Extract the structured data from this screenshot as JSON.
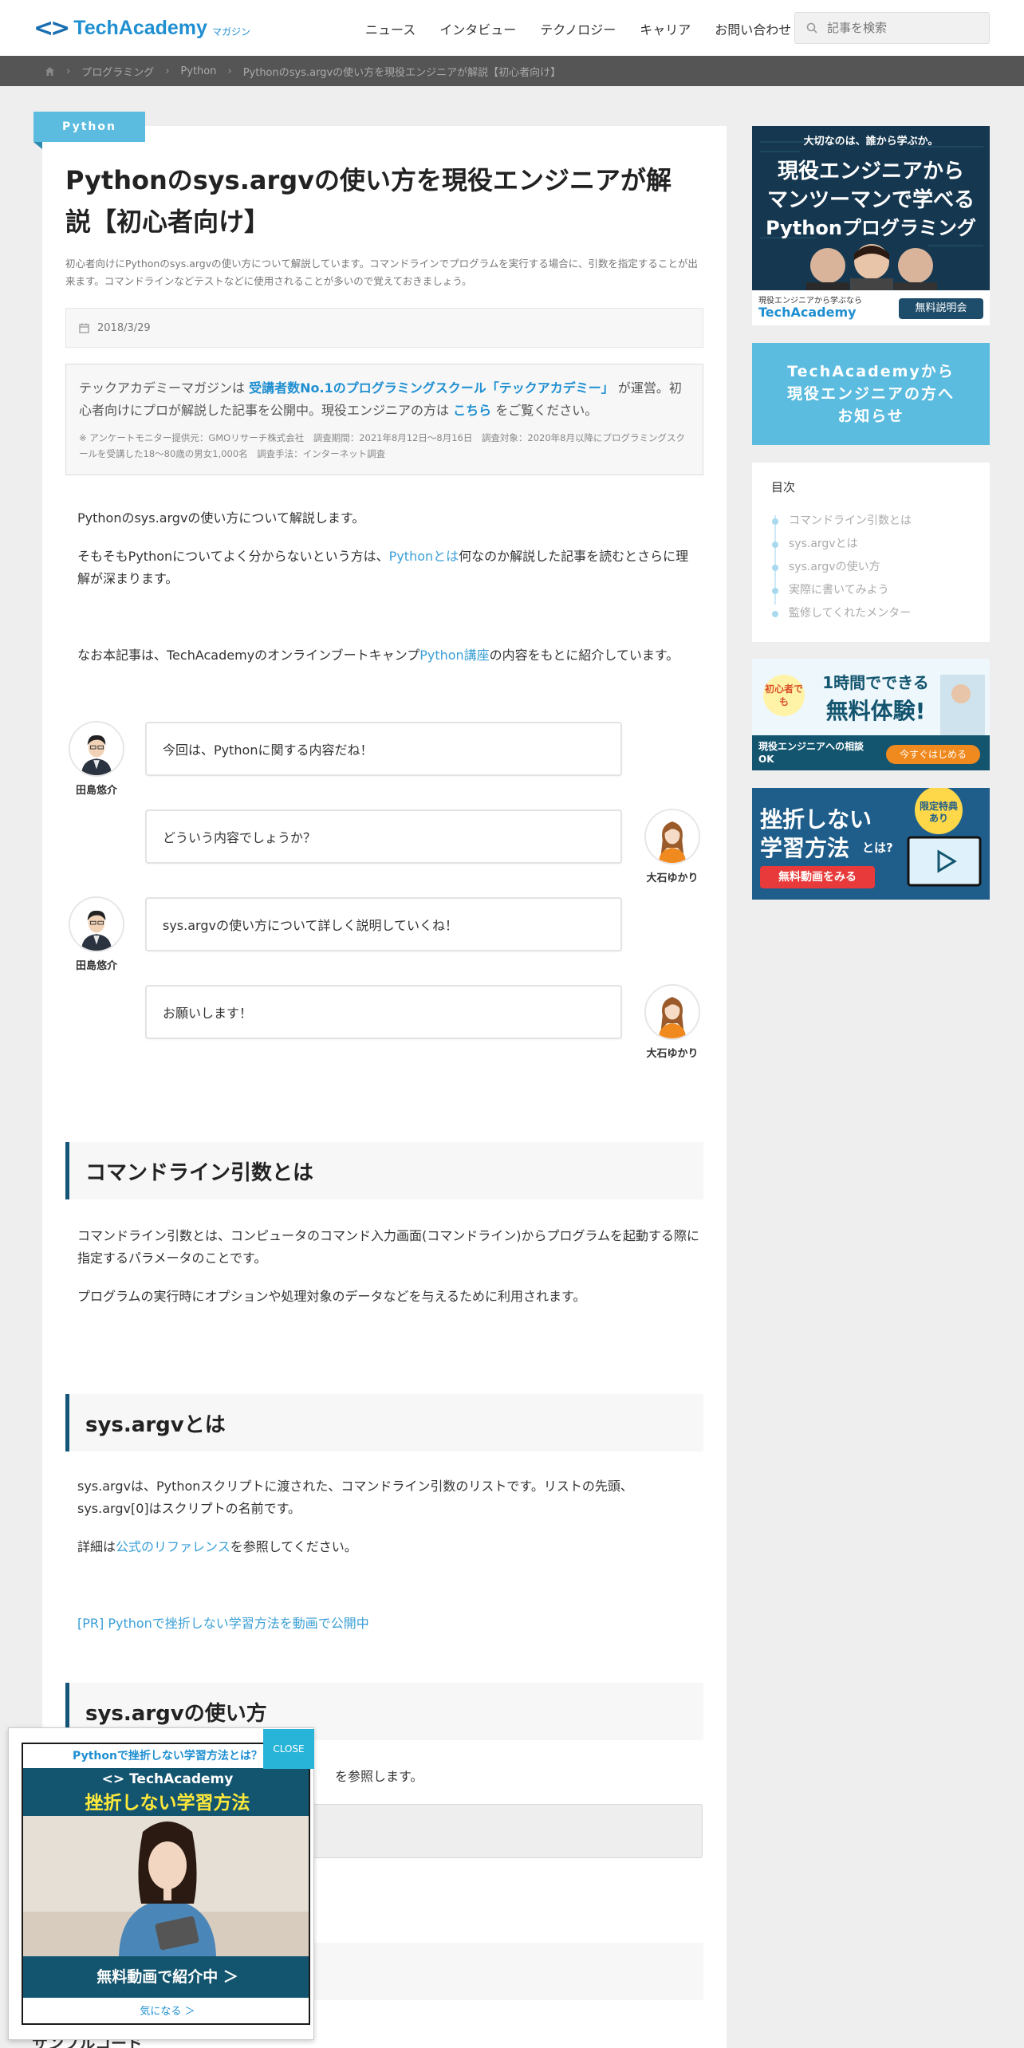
{
  "header": {
    "logo_mark": "<>",
    "logo_text": "TechAcademy",
    "logo_sub": "マガジン",
    "nav": [
      "ニュース",
      "インタビュー",
      "テクノロジー",
      "キャリア",
      "お問い合わせ"
    ],
    "search_placeholder": "記事を検索"
  },
  "breadcrumb": [
    "プログラミング",
    "Python",
    "Pythonのsys.argvの使い方を現役エンジニアが解説【初心者向け】"
  ],
  "article": {
    "category": "Python",
    "title": "Pythonのsys.argvの使い方を現役エンジニアが解説【初心者向け】",
    "lead": "初心者向けにPythonのsys.argvの使い方について解説しています。コマンドラインでプログラムを実行する場合に、引数を指定することが出来ます。コマンドラインなどテストなどに使用されることが多いので覚えておきましょう。",
    "date": "2018/3/29",
    "notice": {
      "prefix": "テックアカデミーマガジンは",
      "highlight": "受講者数No.1のプログラミングスクール「テックアカデミー」",
      "mid": "が運営。初心者向けにプロが解説した記事を公開中。現役エンジニアの方は",
      "link": "こちら",
      "suffix": "をご覧ください。",
      "sub": "※ アンケートモニター提供元：GMOリサーチ株式会社　調査期間：2021年8月12日～8月16日　調査対象：2020年8月以降にプログラミングスクールを受講した18～80歳の男女1,000名　調査手法：インターネット調査"
    },
    "intro1": "Pythonのsys.argvの使い方について解説します。",
    "intro2_pre": "そもそもPythonについてよく分からないという方は、",
    "intro2_link": "Pythonとは",
    "intro2_post": "何なのか解説した記事を読むとさらに理解が深まります。",
    "intro3_pre": "なお本記事は、TechAcademyのオンラインブートキャンプ",
    "intro3_link": "Python講座",
    "intro3_post": "の内容をもとに紹介しています。",
    "chat": [
      {
        "name": "田島悠介",
        "text": "今回は、Pythonに関する内容だね！"
      },
      {
        "name": "大石ゆかり",
        "text": "どういう内容でしょうか？"
      },
      {
        "name": "田島悠介",
        "text": "sys.argvの使い方について詳しく説明していくね！"
      },
      {
        "name": "大石ゆかり",
        "text": "お願いします！"
      }
    ],
    "h2_1": "コマンドライン引数とは",
    "p1": "コマンドライン引数とは、コンピュータのコマンド入力画面(コマンドライン)からプログラムを起動する際に指定するパラメータのことです。",
    "p2": "プログラムの実行時にオプションや処理対象のデータなどを与えるために利用されます。",
    "h2_2": "sys.argvとは",
    "p3": "sys.argvは、Pythonスクリプトに渡された、コマンドライン引数のリストです。リストの先頭、sys.argv[0]はスクリプトの名前です。",
    "p4_pre": "詳細は",
    "p4_link": "公式のリファレンス",
    "p4_post": "を参照してください。",
    "pr_link": "[PR] Pythonで挫折しない学習方法を動画で公開中",
    "h2_3": "sys.argvの使い方",
    "p5_tail": "を参照します。",
    "sample_label": "サンプルコード"
  },
  "sidebar": {
    "banner1": {
      "line1": "大切なのは、誰から学ぶか。",
      "line2": "現役エンジニアから",
      "line3": "マンツーマンで学べる",
      "line4": "Pythonプログラミング",
      "foot": "現役エンジニアから学ぶなら",
      "brand": "TechAcademy",
      "button": "無料説明会"
    },
    "banner2": [
      "TechAcademyから",
      "現役エンジニアの方へ",
      "お知らせ"
    ],
    "toc": {
      "title": "目次",
      "items": [
        "コマンドライン引数とは",
        "sys.argvとは",
        "sys.argvの使い方",
        "実際に書いてみよう",
        "監修してくれたメンター"
      ]
    },
    "banner3": {
      "badge": "初心者でも",
      "line1": "1時間でできる",
      "line2": "無料体験!",
      "sub": "現役エンジニアへの相談OK",
      "button": "今すぐはじめる"
    },
    "banner4": {
      "line1": "挫折しない",
      "line2": "学習方法",
      "line2b": "とは?",
      "badge": "限定特典あり",
      "button": "無料動画をみる"
    }
  },
  "popup": {
    "close": "CLOSE",
    "head": "Pythonで挫折しない学習方法とは？",
    "brand": "<> TechAcademy",
    "catch": "挫折しない学習方法",
    "cta": "無料動画で紹介中 ＞",
    "more": "気になる ＞"
  },
  "colors": {
    "accent": "#5bbce0",
    "link": "#3a9fd6",
    "heading_bar": "#15557a",
    "breadcrumb_bg": "#555555"
  }
}
